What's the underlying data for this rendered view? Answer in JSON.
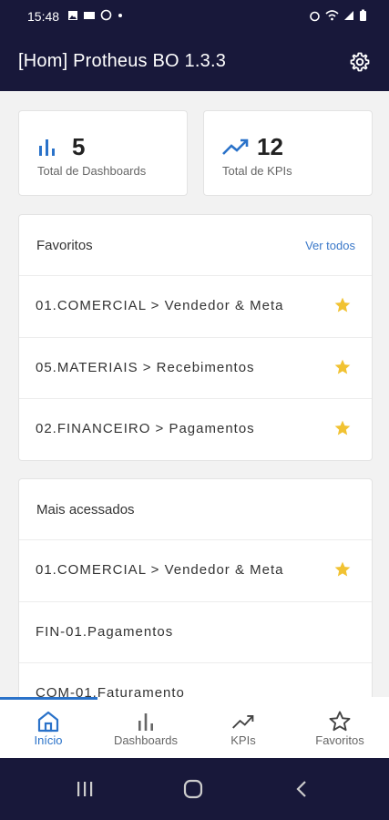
{
  "status_bar": {
    "time": "15:48"
  },
  "app_bar": {
    "title": "[Hom] Protheus BO 1.3.3",
    "settings_icon": "gear-icon"
  },
  "stats": [
    {
      "value": "5",
      "label": "Total de Dashboards",
      "icon": "bar-chart-icon"
    },
    {
      "value": "12",
      "label": "Total de KPIs",
      "icon": "trending-up-icon"
    }
  ],
  "favorites": {
    "title": "Favoritos",
    "see_all": "Ver todos",
    "items": [
      {
        "label": "01.COMERCIAL > Vendedor & Meta",
        "starred": true
      },
      {
        "label": "05.MATERIAIS > Recebimentos",
        "starred": true
      },
      {
        "label": "02.FINANCEIRO > Pagamentos",
        "starred": true
      }
    ]
  },
  "most_accessed": {
    "title": "Mais acessados",
    "items": [
      {
        "label": "01.COMERCIAL > Vendedor & Meta",
        "starred": true
      },
      {
        "label": "FIN-01.Pagamentos",
        "starred": false
      },
      {
        "label": "COM-01.Faturamento",
        "starred": false
      }
    ]
  },
  "bottom_nav": {
    "items": [
      {
        "label": "Início",
        "icon": "home-icon",
        "active": true
      },
      {
        "label": "Dashboards",
        "icon": "bar-chart-icon",
        "active": false
      },
      {
        "label": "KPIs",
        "icon": "trending-up-icon",
        "active": false
      },
      {
        "label": "Favoritos",
        "icon": "star-outline-icon",
        "active": false
      }
    ]
  },
  "colors": {
    "bar_bg": "#18183a",
    "accent": "#2a72c9",
    "star": "#f1c232"
  }
}
